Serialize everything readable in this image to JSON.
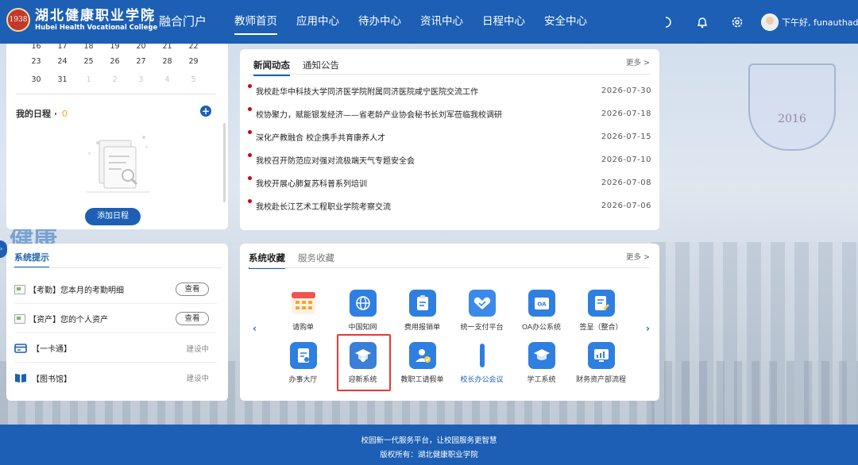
{
  "header": {
    "logo_seal_text": "1938",
    "logo_cn": "湖北健康职业学院",
    "logo_en": "Hubei Health Vocational College",
    "portal_name": "融合门户",
    "nav": [
      {
        "label": "教师首页",
        "active": true
      },
      {
        "label": "应用中心",
        "active": false
      },
      {
        "label": "待办中心",
        "active": false
      },
      {
        "label": "资讯中心",
        "active": false
      },
      {
        "label": "日程中心",
        "active": false
      },
      {
        "label": "安全中心",
        "active": false
      }
    ],
    "icons": [
      "moon-icon",
      "bell-icon",
      "gear-icon"
    ],
    "greeting": "下午好, funauthadmin !"
  },
  "calendar": {
    "row1": [
      "16",
      "17",
      "18",
      "19",
      "20",
      "21",
      "22"
    ],
    "row2": [
      "23",
      "24",
      "25",
      "26",
      "27",
      "28",
      "29"
    ],
    "row3": [
      "30",
      "31",
      "1",
      "2",
      "3",
      "4",
      "5"
    ]
  },
  "schedule": {
    "title": "我的日程",
    "separator": "·",
    "count": "0",
    "add_button": "添加日程"
  },
  "news": {
    "tabs": [
      "新闻动态",
      "通知公告"
    ],
    "more": "更多 >",
    "items": [
      {
        "title": "我校赴华中科技大学同济医学院附属同济医院咸宁医院交流工作",
        "date": "2026-07-30"
      },
      {
        "title": "校协聚力，赋能银发经济——省老龄产业协会秘书长刘军莅临我校调研",
        "date": "2026-07-18"
      },
      {
        "title": "深化产教融合 校企携手共育康养人才",
        "date": "2026-07-15"
      },
      {
        "title": "我校召开防范应对强对流极端天气专题安全会",
        "date": "2026-07-10"
      },
      {
        "title": "我校开展心肺复苏科普系列培训",
        "date": "2026-07-08"
      },
      {
        "title": "我校赴长江艺术工程职业学院考察交流",
        "date": "2026-07-06"
      }
    ]
  },
  "tips": {
    "title": "系统提示",
    "items": [
      {
        "label": "【考勤】您本月的考勤明细",
        "action": "查看"
      },
      {
        "label": "【资产】您的个人资产",
        "action": "查看"
      },
      {
        "label": "【一卡通】",
        "status": "建设中"
      },
      {
        "label": "【图书馆】",
        "status": "建设中"
      }
    ]
  },
  "apps": {
    "tabs": [
      "系统收藏",
      "服务收藏"
    ],
    "more": "更多 >",
    "prev": "‹",
    "next": "›",
    "row1": [
      {
        "label": "请购单",
        "icon": "calendar-grid-icon"
      },
      {
        "label": "中国知网",
        "icon": "globe-icon"
      },
      {
        "label": "费用报销单",
        "icon": "clipboard-icon"
      },
      {
        "label": "统一支付平台",
        "icon": "handshake-icon"
      },
      {
        "label": "OA办公系统",
        "icon": "oa-folder-icon"
      },
      {
        "label": "签呈（整合）",
        "icon": "sign-doc-icon"
      }
    ],
    "row2": [
      {
        "label": "办事大厅",
        "icon": "doc-edit-icon"
      },
      {
        "label": "迎新系统",
        "icon": "graduation-cap-icon"
      },
      {
        "label": "教职工请假单",
        "icon": "user-check-icon"
      },
      {
        "label": "校长办公会议",
        "icon": "bar-icon"
      },
      {
        "label": "学工系统",
        "icon": "mortarboard-icon"
      },
      {
        "label": "财务资产部流程",
        "icon": "finance-chart-icon"
      }
    ],
    "oa_badge": "OA"
  },
  "footer": {
    "line1": "校园新一代服务平台，让校园服务更智慧",
    "line2": "版权所有：湖北健康职业学院"
  },
  "background": {
    "emblem_year": "2016",
    "banner_text": "健康"
  },
  "colors": {
    "primary": "#1c5fb5",
    "news_dot": "#d0021b",
    "count": "#f5a623",
    "highlight_box": "#e53935"
  }
}
